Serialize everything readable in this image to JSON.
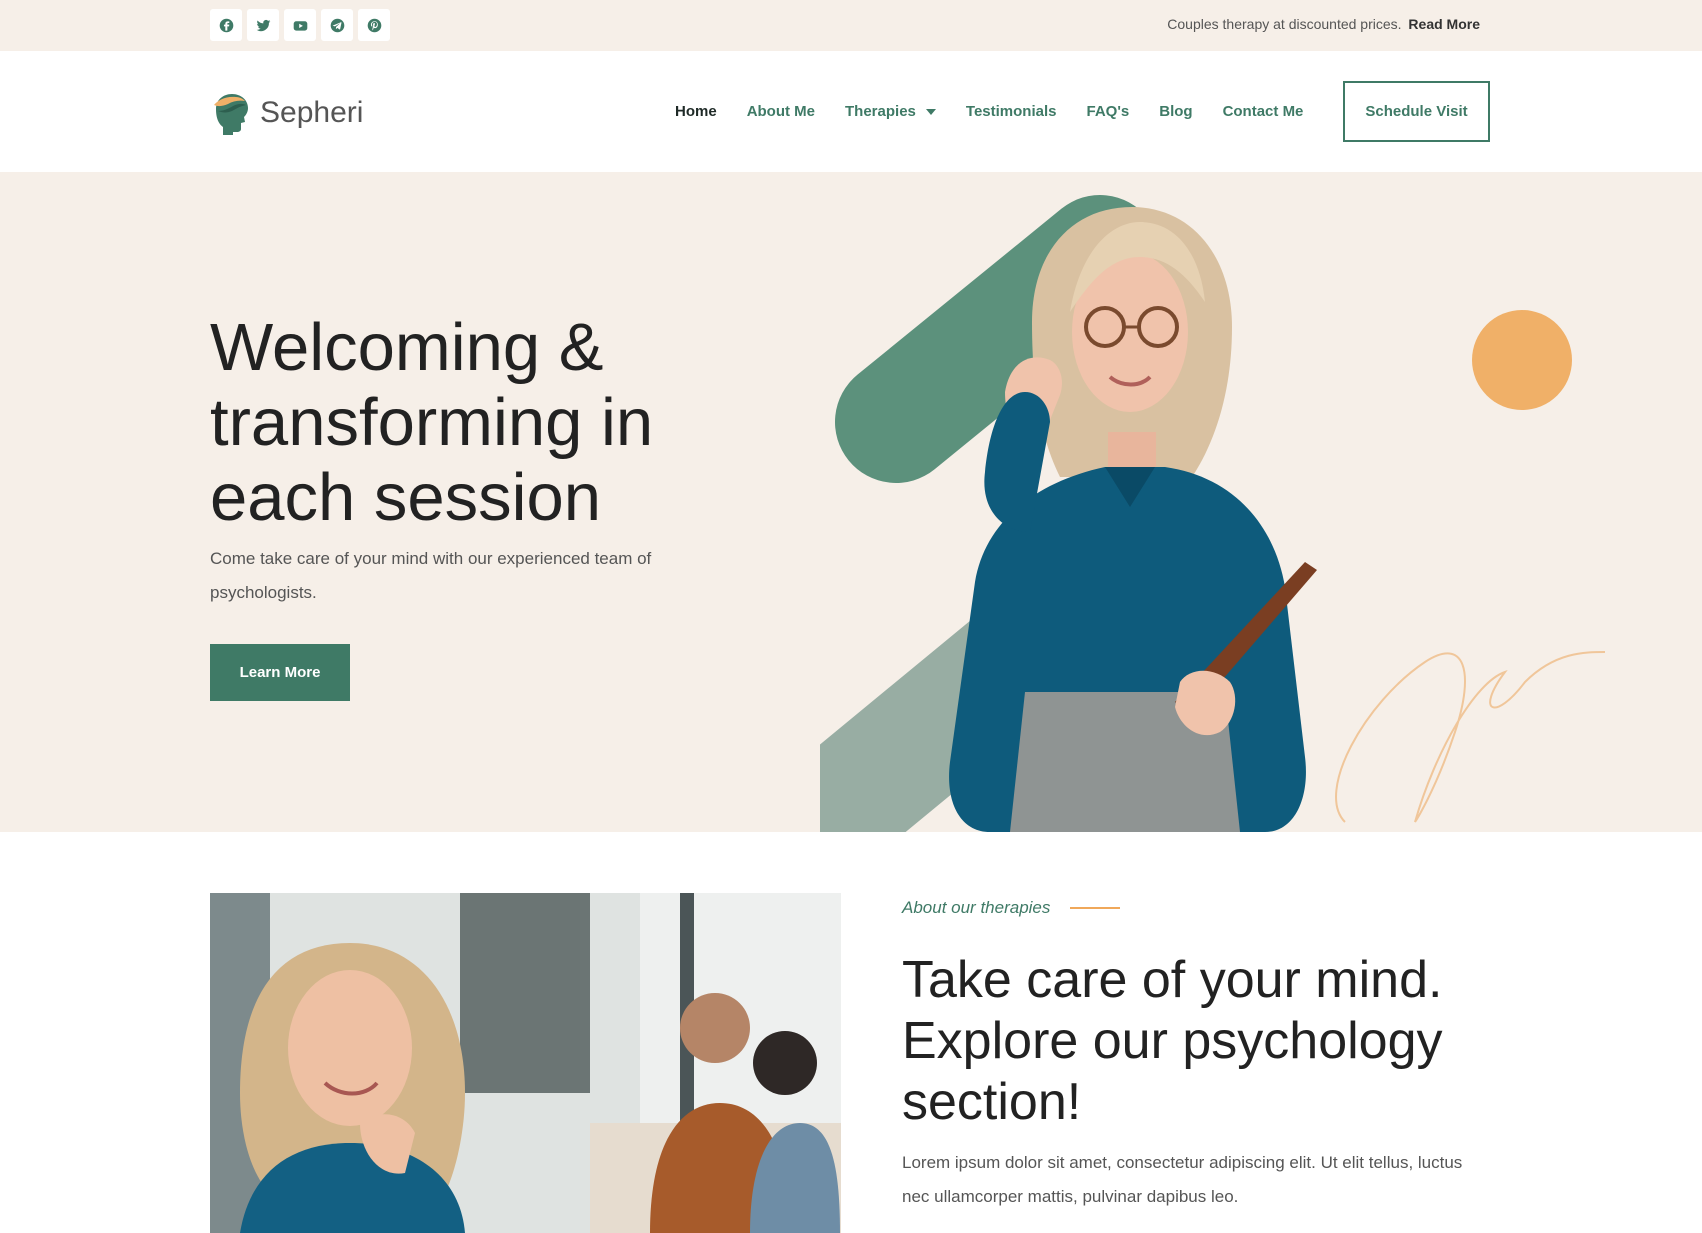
{
  "topbar": {
    "social": [
      {
        "name": "facebook-icon"
      },
      {
        "name": "twitter-icon"
      },
      {
        "name": "youtube-icon"
      },
      {
        "name": "telegram-icon"
      },
      {
        "name": "pinterest-icon"
      }
    ],
    "promo_text": "Couples therapy at discounted prices.",
    "promo_link": "Read More"
  },
  "header": {
    "logo_text": "Sepheri",
    "nav": {
      "home": "Home",
      "about": "About Me",
      "therapies": "Therapies",
      "testimonials": "Testimonials",
      "faq": "FAQ's",
      "blog": "Blog",
      "contact": "Contact Me"
    },
    "cta": "Schedule Visit"
  },
  "hero": {
    "title": "Welcoming & transforming in each session",
    "subtitle": "Come take care of your mind with our experienced team of psychologists.",
    "button": "Learn More"
  },
  "about": {
    "eyebrow": "About our therapies",
    "title": "Take care of your mind. Explore our psychology section!",
    "text": "Lorem ipsum dolor sit amet, consectetur adipiscing elit. Ut elit tellus, luctus nec ullamcorper mattis, pulvinar dapibus leo."
  },
  "colors": {
    "brand_green": "#3f7a66",
    "accent_orange": "#f0b068",
    "hero_bg": "#f6efe8",
    "text_dark": "#222222"
  }
}
